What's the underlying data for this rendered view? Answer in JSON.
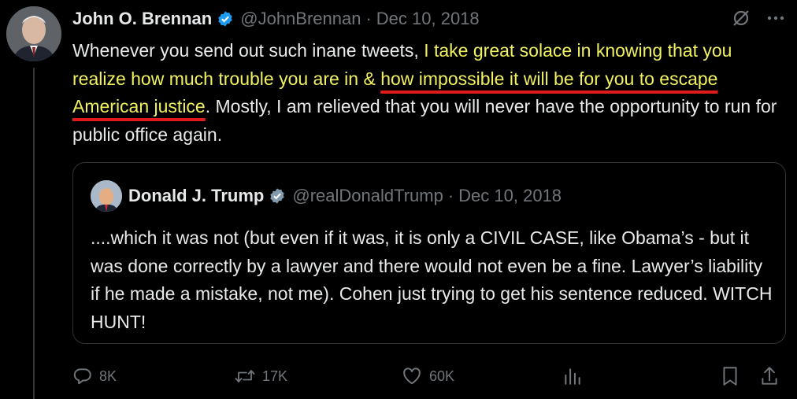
{
  "author": {
    "name": "John O. Brennan",
    "handle": "@JohnBrennan",
    "date": "Dec 10, 2018",
    "verified_color": "#1d9bf0"
  },
  "tweet": {
    "segments": [
      {
        "text": "Whenever you send out such inane tweets, ",
        "style": "plain"
      },
      {
        "text": "I take great solace in knowing that you realize how much trouble you are in & ",
        "style": "highlight"
      },
      {
        "text": "how impossible it will be for you to escape American justice",
        "style": "highlight-underline"
      },
      {
        "text": ". Mostly, I am relieved that you will never have the opportunity to run for public office again.",
        "style": "plain"
      }
    ],
    "highlight_color": "#f1f15f",
    "underline_color": "#e01b1b"
  },
  "quoted": {
    "name": "Donald J. Trump",
    "handle": "@realDonaldTrump",
    "date": "Dec 10, 2018",
    "verified_color": "#829aab",
    "text": "....which it was not (but even if it was, it is only a CIVIL CASE, like Obama’s - but it was done correctly by a lawyer and there would not even be a fine. Lawyer’s liability if he made a mistake, not me). Cohen just trying to get his sentence reduced. WITCH HUNT!"
  },
  "top_icons": [
    "grok-slash-icon",
    "more-dots-icon"
  ],
  "actions": {
    "reply_count": "8K",
    "retweet_count": "17K",
    "like_count": "60K",
    "icons": [
      "reply-icon",
      "retweet-icon",
      "like-icon",
      "views-icon",
      "bookmark-icon",
      "share-icon"
    ]
  }
}
